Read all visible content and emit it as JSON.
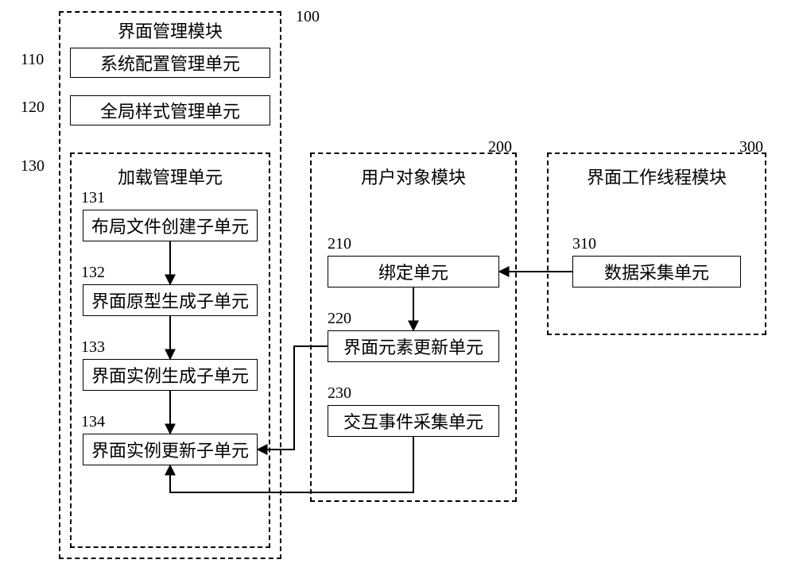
{
  "module100": {
    "ref": "100",
    "title": "界面管理模块",
    "box110": {
      "ref": "110",
      "label": "系统配置管理单元"
    },
    "box120": {
      "ref": "120",
      "label": "全局样式管理单元"
    },
    "sub130": {
      "ref": "130",
      "title": "加载管理单元",
      "box131": {
        "ref": "131",
        "label": "布局文件创建子单元"
      },
      "box132": {
        "ref": "132",
        "label": "界面原型生成子单元"
      },
      "box133": {
        "ref": "133",
        "label": "界面实例生成子单元"
      },
      "box134": {
        "ref": "134",
        "label": "界面实例更新子单元"
      }
    }
  },
  "module200": {
    "ref": "200",
    "title": "用户对象模块",
    "box210": {
      "ref": "210",
      "label": "绑定单元"
    },
    "box220": {
      "ref": "220",
      "label": "界面元素更新单元"
    },
    "box230": {
      "ref": "230",
      "label": "交互事件采集单元"
    }
  },
  "module300": {
    "ref": "300",
    "title": "界面工作线程模块",
    "box310": {
      "ref": "310",
      "label": "数据采集单元"
    }
  }
}
